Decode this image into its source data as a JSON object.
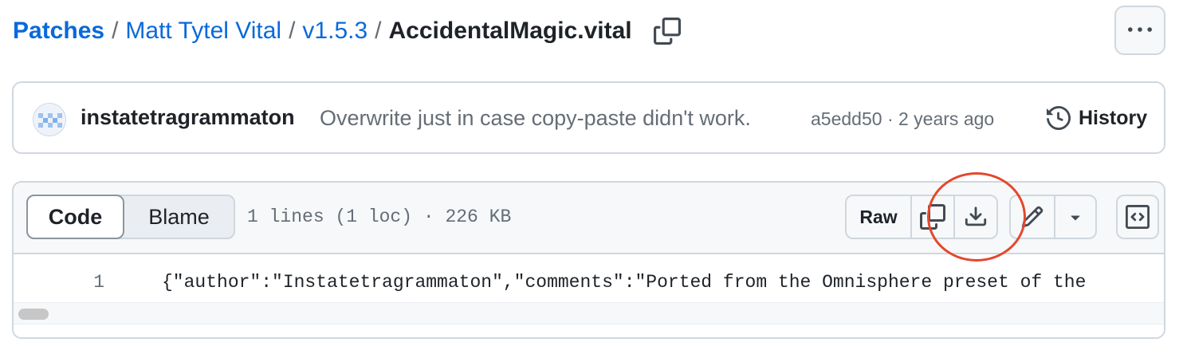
{
  "breadcrumb": {
    "items": [
      "Patches",
      "Matt Tytel Vital",
      "v1.5.3"
    ],
    "separator": "/",
    "current": "AccidentalMagic.vital"
  },
  "icons": {
    "copy_path": "copy-icon",
    "more": "kebab-horizontal-icon",
    "history": "history-icon",
    "copy_raw": "copy-icon",
    "download": "download-icon",
    "edit": "pencil-icon",
    "dropdown": "triangle-down-icon",
    "symbols": "code-square-icon"
  },
  "commit": {
    "author": "instatetragrammaton",
    "message": "Overwrite just in case copy-paste didn't work.",
    "sha": "a5edd50",
    "dot": "·",
    "time": "2 years ago",
    "history_label": "History"
  },
  "file_header": {
    "tabs": [
      "Code",
      "Blame"
    ],
    "active_tab": "Code",
    "info": "1 lines (1 loc) · 226 KB",
    "raw_label": "Raw"
  },
  "code": {
    "line_number": "1",
    "line_text": "{\"author\":\"Instatetragrammaton\",\"comments\":\"Ported from the Omnisphere preset of the"
  },
  "colors": {
    "link": "#0969da",
    "border": "#d0d7de",
    "muted": "#656d76",
    "annotation": "#e4472b"
  }
}
